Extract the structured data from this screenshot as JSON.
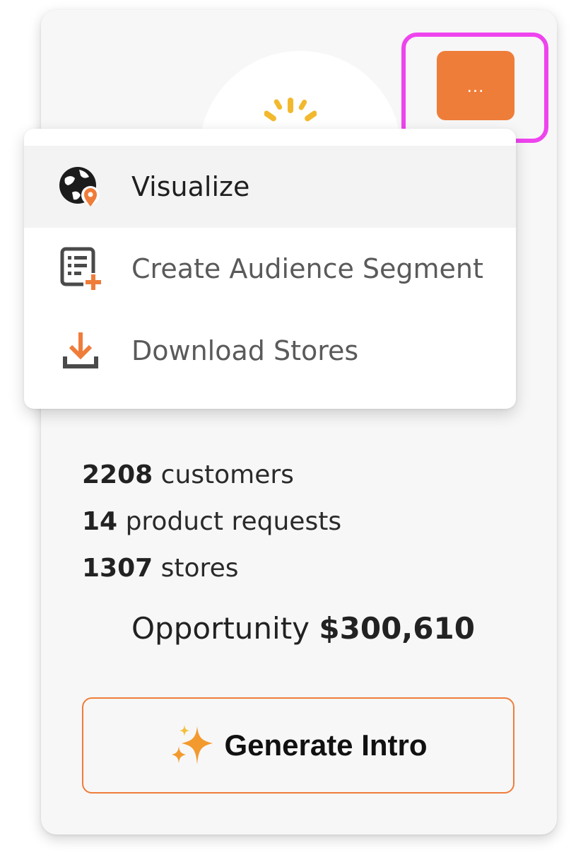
{
  "header": {
    "more_button_label": "...",
    "logo_icon": "spark-logo-icon"
  },
  "menu": {
    "items": [
      {
        "label": "Visualize",
        "icon": "globe-pin-icon",
        "active": true
      },
      {
        "label": "Create Audience Segment",
        "icon": "list-add-icon",
        "active": false
      },
      {
        "label": "Download Stores",
        "icon": "download-icon",
        "active": false
      }
    ]
  },
  "stats": {
    "customers_value": "2208",
    "customers_label": "customers",
    "requests_value": "14",
    "requests_label": "product requests",
    "stores_value": "1307",
    "stores_label": "stores"
  },
  "opportunity": {
    "label": "Opportunity",
    "value": "$300,610"
  },
  "generate_button": {
    "label": "Generate Intro",
    "icon": "sparkles-icon"
  },
  "colors": {
    "accent": "#ef7d3a",
    "highlight": "#ee44ee",
    "logo_yellow": "#f2b92e",
    "card_bg": "#f7f7f7"
  }
}
